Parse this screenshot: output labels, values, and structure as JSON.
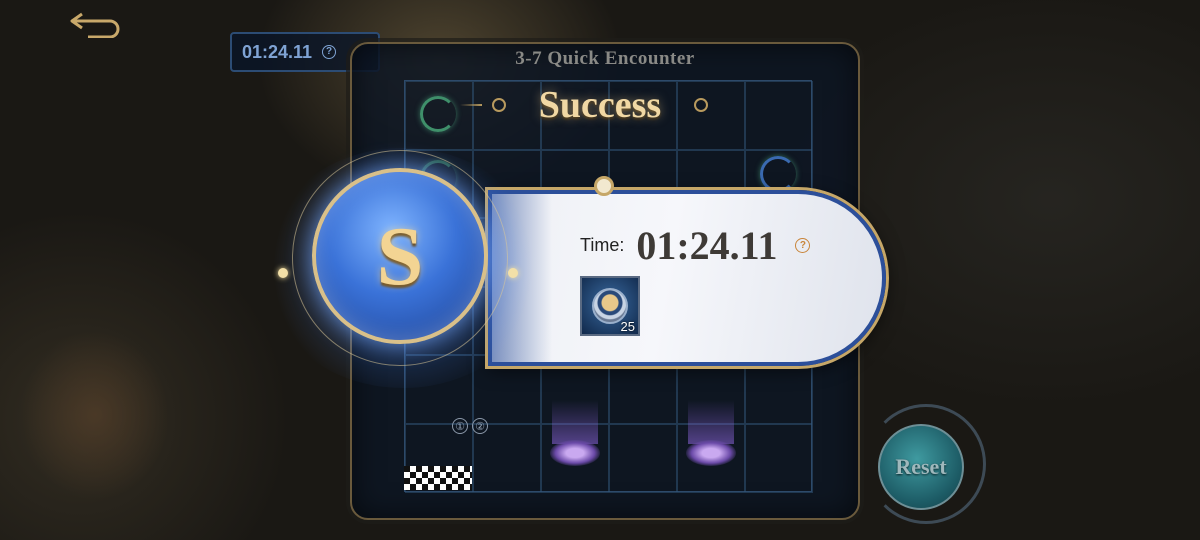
{
  "header": {
    "back_icon": "back-arrow-icon",
    "timer": "01:24.11",
    "help_icon": "question-circle-icon"
  },
  "stage": {
    "title": "3-7  Quick Encounter",
    "banner": "Success"
  },
  "result": {
    "grade": "S",
    "time_label": "Time:",
    "time_value": "01:24.11",
    "help_icon": "question-circle-icon",
    "reward": {
      "icon": "coin-medal-icon",
      "quantity": "25"
    }
  },
  "board": {
    "step_labels": [
      "①",
      "②"
    ],
    "finish_icon": "checkered-flag-icon"
  },
  "controls": {
    "reset_label": "Reset"
  },
  "colors": {
    "accent_gold": "#c6a768",
    "card_border_blue": "#2c4f9a",
    "grade_text": "#f3d493",
    "reset_teal": "#1d5c66"
  }
}
